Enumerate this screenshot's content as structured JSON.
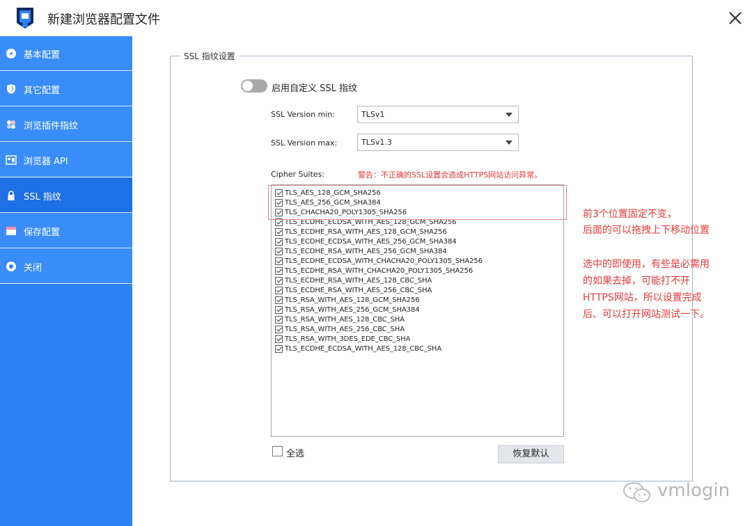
{
  "window": {
    "title": "新建浏览器配置文件"
  },
  "sidebar": {
    "items": [
      {
        "label": "基本配置",
        "icon": "compass-icon"
      },
      {
        "label": "其它配置",
        "icon": "shield-icon"
      },
      {
        "label": "浏览插件指纹",
        "icon": "plugin-icon"
      },
      {
        "label": "浏览器 API",
        "icon": "api-icon"
      },
      {
        "label": "SSL 指纹",
        "icon": "lock-icon",
        "active": true
      },
      {
        "label": "保存配置",
        "icon": "save-icon"
      },
      {
        "label": "关闭",
        "icon": "power-icon"
      }
    ]
  },
  "ssl": {
    "legend": "SSL 指纹设置",
    "toggle_label": "启用自定义 SSL 指纹",
    "toggle_on": false,
    "version_min_label": "SSL Version min:",
    "version_min_value": "TLSv1",
    "version_max_label": "SSL Version max:",
    "version_max_value": "TLSv1.3",
    "cipher_label": "Cipher Suites:",
    "warning": "警告：不正确的SSL设置会造成HTTPS网站访问异常。",
    "ciphers": [
      "TLS_AES_128_GCM_SHA256",
      "TLS_AES_256_GCM_SHA384",
      "TLS_CHACHA20_POLY1305_SHA256",
      "TLS_ECDHE_ECDSA_WITH_AES_128_GCM_SHA256",
      "TLS_ECDHE_RSA_WITH_AES_128_GCM_SHA256",
      "TLS_ECDHE_ECDSA_WITH_AES_256_GCM_SHA384",
      "TLS_ECDHE_RSA_WITH_AES_256_GCM_SHA384",
      "TLS_ECDHE_ECDSA_WITH_CHACHA20_POLY1305_SHA256",
      "TLS_ECDHE_RSA_WITH_CHACHA20_POLY1305_SHA256",
      "TLS_ECDHE_RSA_WITH_AES_128_CBC_SHA",
      "TLS_ECDHE_RSA_WITH_AES_256_CBC_SHA",
      "TLS_RSA_WITH_AES_128_GCM_SHA256",
      "TLS_RSA_WITH_AES_256_GCM_SHA384",
      "TLS_RSA_WITH_AES_128_CBC_SHA",
      "TLS_RSA_WITH_AES_256_CBC_SHA",
      "TLS_RSA_WITH_3DES_EDE_CBC_SHA",
      "TLS_ECDHE_ECDSA_WITH_AES_128_CBC_SHA"
    ],
    "select_all_label": "全选",
    "restore_label": "恢复默认"
  },
  "annotation": {
    "line1": "前3个位置固定不变，",
    "line2": "后面的可以拖拽上下移动位置",
    "line3": "选中的即使用，有些是必需用",
    "line4": "的如果去掉，可能打不开",
    "line5": "HTTPS网站，所以设置完成",
    "line6": "后、可以打开网站测试一下。"
  },
  "watermark": {
    "text": "vmlogin"
  },
  "colors": {
    "sidebar": "#2f82f6",
    "sidebar_active": "#1f6fe6",
    "warning": "#e53935"
  }
}
